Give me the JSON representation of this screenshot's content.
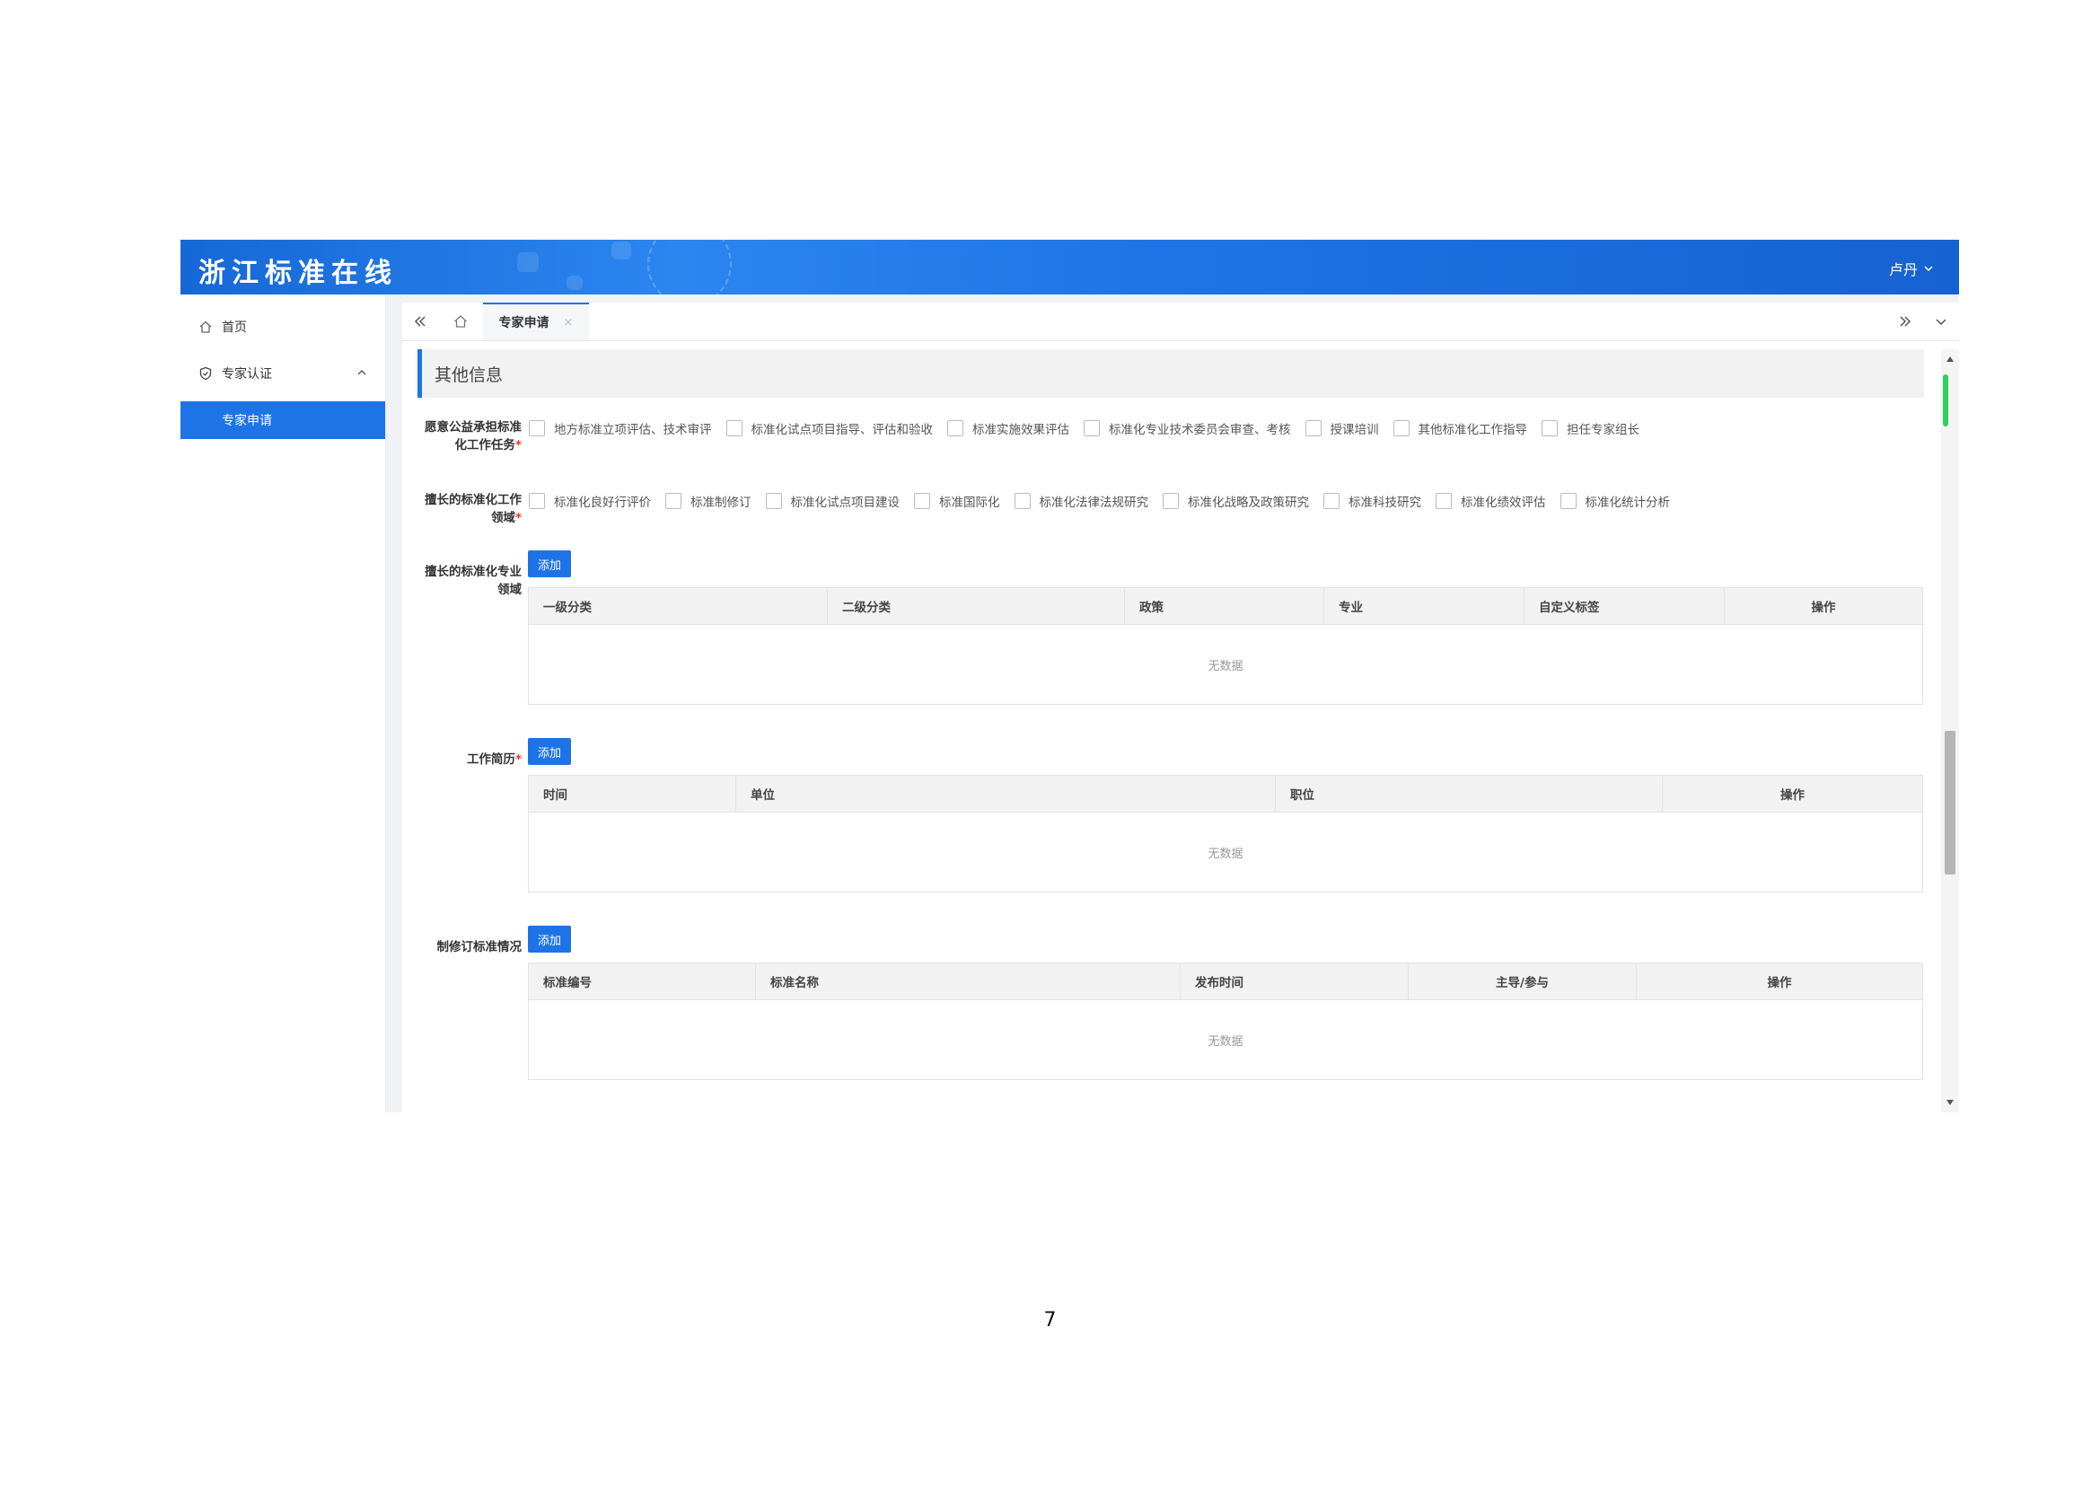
{
  "header": {
    "logo": "浙江标准在线",
    "user_name": "卢丹"
  },
  "sidebar": {
    "items": [
      {
        "label": "首页",
        "icon": "home-icon"
      },
      {
        "label": "专家认证",
        "icon": "shield-check-icon"
      },
      {
        "label": "专家申请"
      }
    ]
  },
  "tabs": [
    {
      "label": "专家申请",
      "close": "×"
    }
  ],
  "section": {
    "title": "其他信息"
  },
  "form": {
    "tasks": {
      "label": "愿意公益承担标准化工作任务",
      "required": "*",
      "options": [
        "地方标准立项评估、技术审评",
        "标准化试点项目指导、评估和验收",
        "标准实施效果评估",
        "标准化专业技术委员会审查、考核",
        "授课培训",
        "其他标准化工作指导",
        "担任专家组长"
      ]
    },
    "fields": {
      "label": "擅长的标准化工作领域",
      "required": "*",
      "options": [
        "标准化良好行评价",
        "标准制修订",
        "标准化试点项目建设",
        "标准国际化",
        "标准化法律法规研究",
        "标准化战略及政策研究",
        "标准科技研究",
        "标准化绩效评估",
        "标准化统计分析"
      ]
    },
    "specialty": {
      "label": "擅长的标准化专业领域",
      "add_label": "添加",
      "columns": [
        "一级分类",
        "二级分类",
        "政策",
        "专业",
        "自定义标签",
        "操作"
      ],
      "empty_text": "无数据"
    },
    "resume": {
      "label": "工作简历",
      "required": "*",
      "add_label": "添加",
      "columns": [
        "时间",
        "单位",
        "职位",
        "操作"
      ],
      "empty_text": "无数据"
    },
    "standards": {
      "label": "制修订标准情况",
      "add_label": "添加",
      "columns": [
        "标准编号",
        "标准名称",
        "发布时间",
        "主导/参与",
        "操作"
      ],
      "empty_text": "无数据"
    }
  },
  "page_number": "7"
}
